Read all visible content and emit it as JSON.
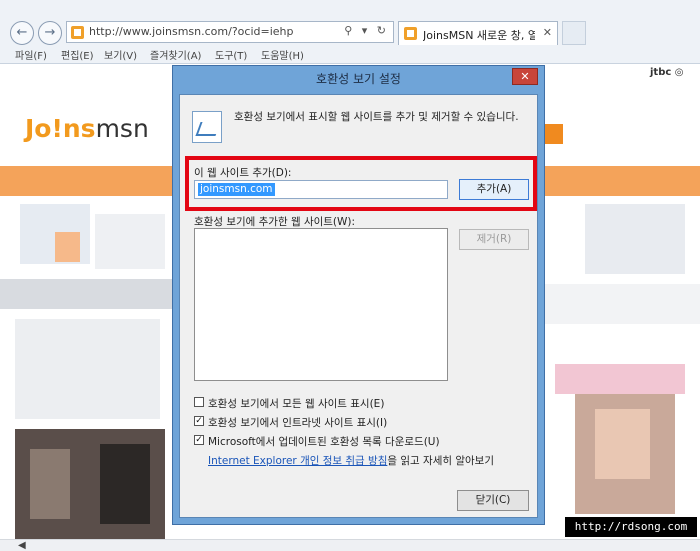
{
  "browser": {
    "url": "http://www.joinsmsn.com/?ocid=iehp",
    "address_icons": "⚲ ▾ ↻",
    "tab_title": "JoinsMSN 새로운 창, 열린...",
    "tab_close": "✕",
    "back_icon": "←",
    "forward_icon": "→",
    "menu": [
      "파일(F)",
      "편집(E)",
      "보기(V)",
      "즐겨찾기(A)",
      "도구(T)",
      "도움말(H)"
    ]
  },
  "page": {
    "logo_prefix": "Jo!ns",
    "logo_suffix": "msn",
    "jtbc": "jtbc ◎"
  },
  "dialog": {
    "title": "호환성 보기 설정",
    "close_glyph": "✕",
    "description": "호환성 보기에서 표시할 웹 사이트를 추가 및 제거할 수 있습니다.",
    "add_label": "이 웹 사이트 추가(D):",
    "add_input_value": "joinsmsn.com",
    "add_button": "추가(A)",
    "list_label": "호환성 보기에 추가한 웹 사이트(W):",
    "remove_button": "제거(R)",
    "checkboxes": [
      {
        "label": "호환성 보기에서 모든 웹 사이트 표시(E)",
        "checked": false,
        "mark": ""
      },
      {
        "label": "호환성 보기에서 인트라넷 사이트 표시(I)",
        "checked": true,
        "mark": "✓"
      },
      {
        "label": "Microsoft에서 업데이트된 호환성 목록 다운로드(U)",
        "checked": true,
        "mark": "✓"
      }
    ],
    "privacy_link": "Internet Explorer 개인 정보 취급 방침",
    "privacy_suffix": "을 읽고 자세히 알아보기",
    "close_button": "닫기(C)"
  },
  "watermark": "http://rdsong.com",
  "scroll_arrow": "◀",
  "colors": {
    "highlight": "#e30613",
    "dialog_frame": "#6fa4d8",
    "accent_orange": "#f29a1e",
    "selection": "#3399ff",
    "link": "#1a55b8"
  }
}
